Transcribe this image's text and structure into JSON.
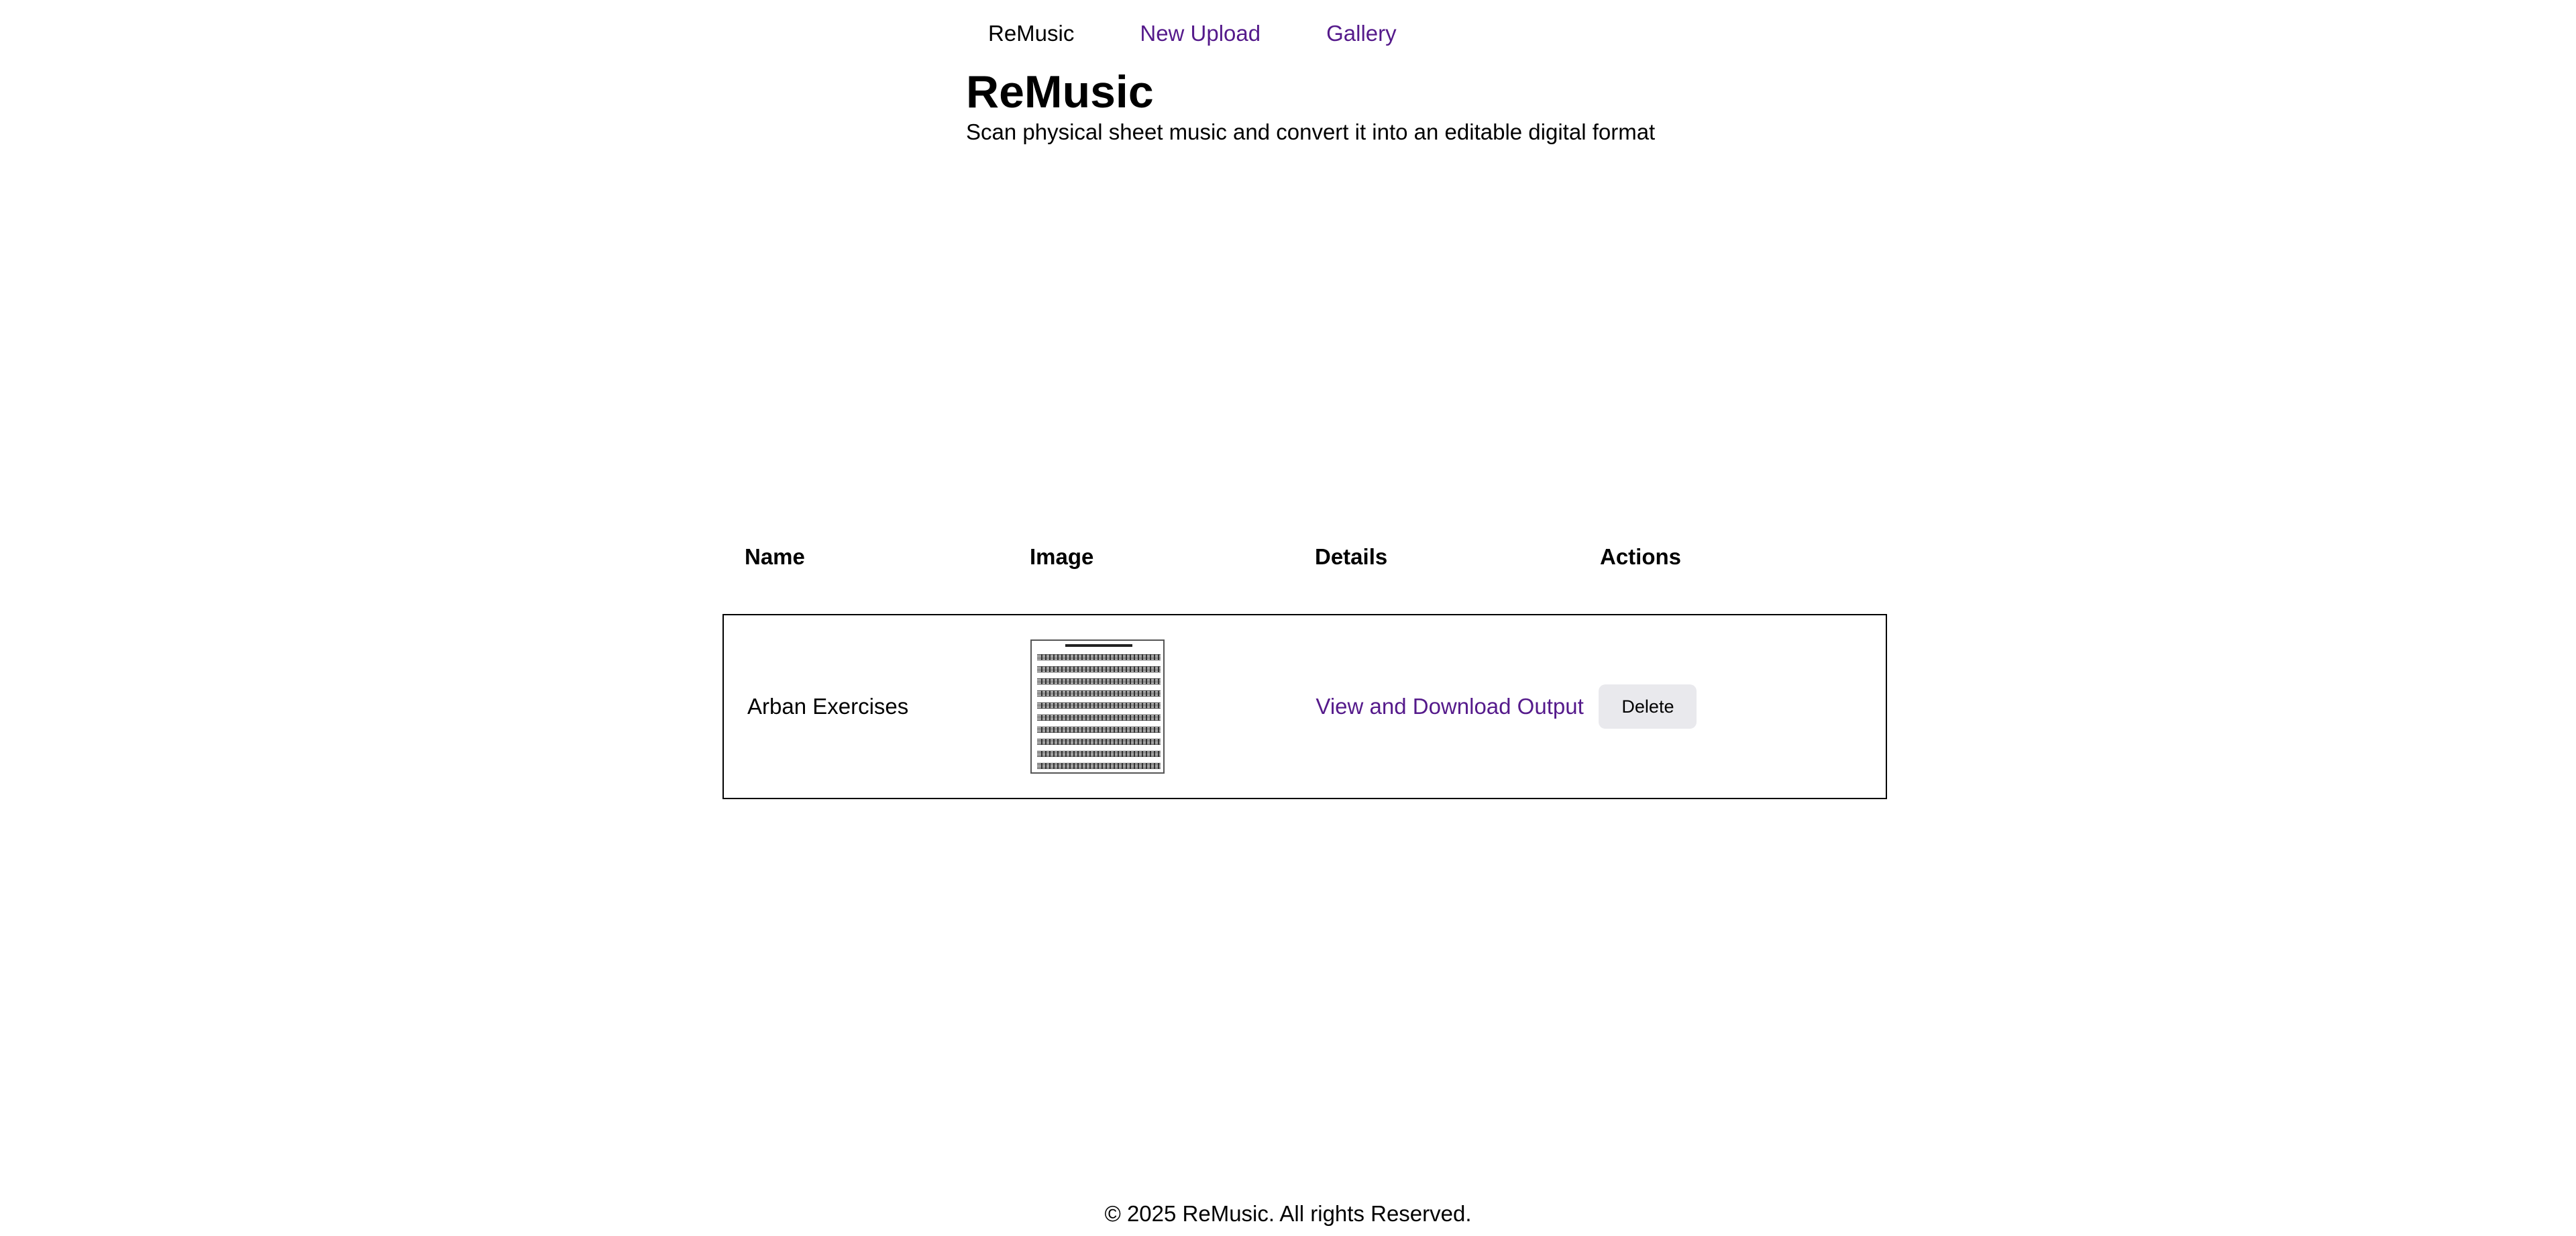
{
  "nav": {
    "brand": "ReMusic",
    "links": [
      {
        "label": "New Upload"
      },
      {
        "label": "Gallery"
      }
    ]
  },
  "header": {
    "title": "ReMusic",
    "subtitle": "Scan physical sheet music and convert it into an editable digital format"
  },
  "table": {
    "columns": [
      "Name",
      "Image",
      "Details",
      "Actions"
    ],
    "rows": [
      {
        "name": "Arban Exercises",
        "image_icon": "sheet-music-thumbnail",
        "details_link": "View and Download Output",
        "action_label": "Delete"
      }
    ]
  },
  "footer": {
    "text": "© 2025 ReMusic. All rights Reserved."
  },
  "colors": {
    "link": "#551a8b",
    "button_bg": "#e9e9ed",
    "border": "#000000"
  }
}
